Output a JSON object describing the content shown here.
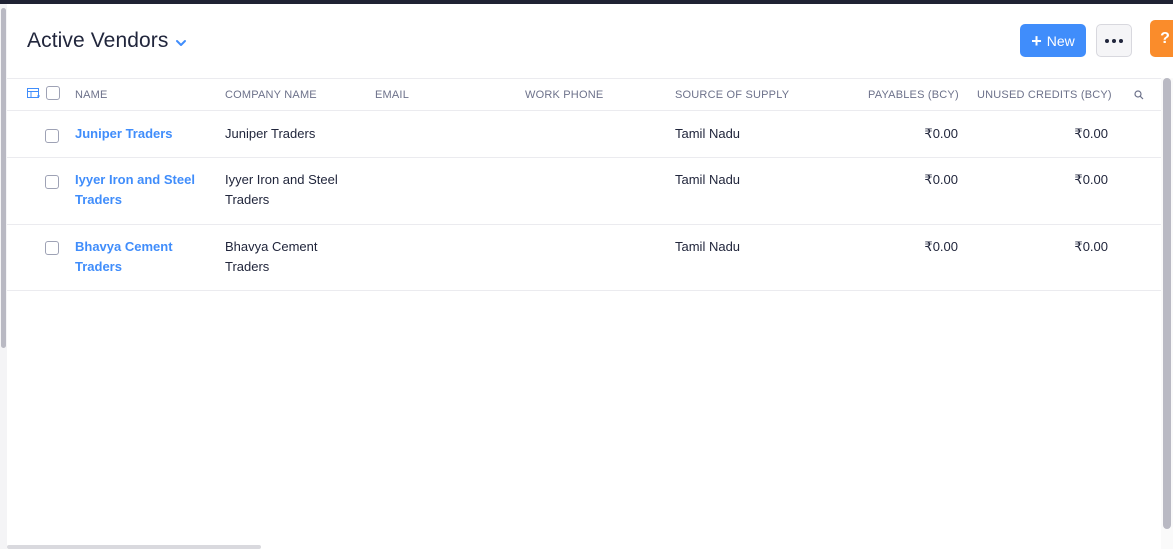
{
  "header": {
    "title": "Active Vendors",
    "new_label": "New",
    "help_label": "?"
  },
  "table": {
    "columns": {
      "name": "NAME",
      "company": "COMPANY NAME",
      "email": "EMAIL",
      "phone": "WORK PHONE",
      "source": "SOURCE OF SUPPLY",
      "payables": "PAYABLES (BCY)",
      "credits": "UNUSED CREDITS (BCY)"
    },
    "rows": [
      {
        "name": [
          "Juniper Traders"
        ],
        "company": [
          "Juniper Traders"
        ],
        "email": "",
        "phone": "",
        "source": "Tamil Nadu",
        "payables": "₹0.00",
        "credits": "₹0.00"
      },
      {
        "name": [
          "Iyyer Iron and Steel",
          "Traders"
        ],
        "company": [
          "Iyyer Iron and Steel",
          "Traders"
        ],
        "email": "",
        "phone": "",
        "source": "Tamil Nadu",
        "payables": "₹0.00",
        "credits": "₹0.00"
      },
      {
        "name": [
          "Bhavya Cement",
          "Traders"
        ],
        "company": [
          "Bhavya Cement",
          "Traders"
        ],
        "email": "",
        "phone": "",
        "source": "Tamil Nadu",
        "payables": "₹0.00",
        "credits": "₹0.00"
      }
    ]
  },
  "colors": {
    "accent": "#408dfb",
    "help": "#fa8c2b",
    "text": "#21263c",
    "muted": "#6c718a"
  },
  "icons": [
    "chevron-down-icon",
    "plus-icon",
    "more-icon",
    "help-icon",
    "column-settings-icon",
    "search-icon"
  ]
}
